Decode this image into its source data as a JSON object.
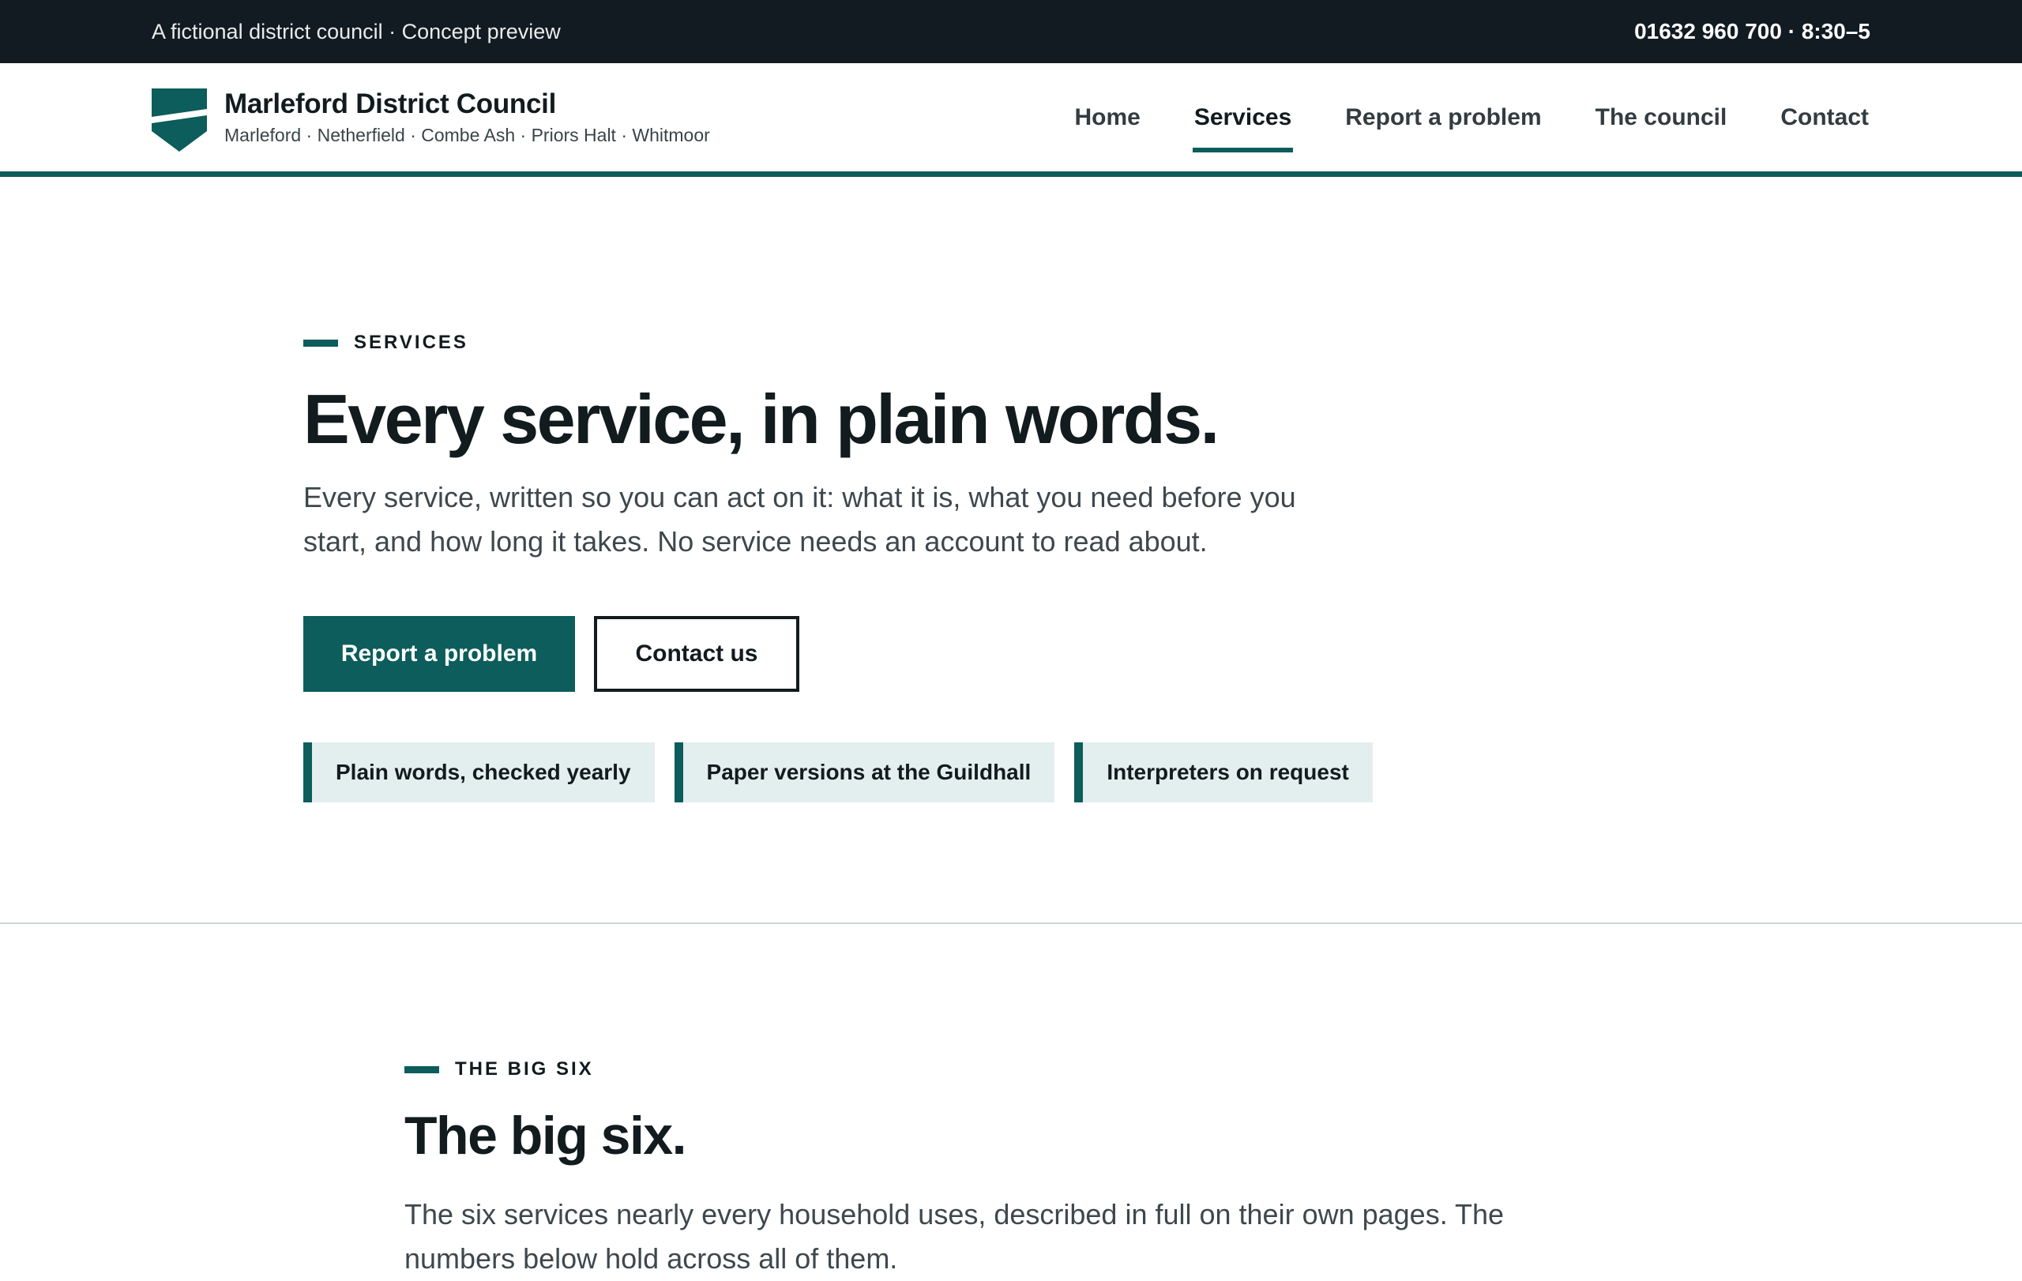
{
  "utility_bar": {
    "left_text": "A fictional district council · Concept preview",
    "right_text": "01632 960 700 · 8:30–5"
  },
  "header": {
    "brand_name": "Marleford District Council",
    "places": "Marleford · Netherfield · Combe Ash · Priors Halt · Whitmoor",
    "nav": [
      {
        "label": "Home",
        "active": false
      },
      {
        "label": "Services",
        "active": true
      },
      {
        "label": "Report a problem",
        "active": false
      },
      {
        "label": "The council",
        "active": false
      },
      {
        "label": "Contact",
        "active": false
      }
    ]
  },
  "hero": {
    "eyebrow": "SERVICES",
    "title": "Every service, in plain words.",
    "lede": "Every service, written so you can act on it: what it is, what you need before you start, and how long it takes. No service needs an account to read about.",
    "primary_cta": "Report a problem",
    "secondary_cta": "Contact us",
    "badges": [
      "Plain words, checked yearly",
      "Paper versions at the Guildhall",
      "Interpreters on request"
    ]
  },
  "big_six": {
    "eyebrow": "THE BIG SIX",
    "title": "The big six.",
    "lede": "The six services nearly every household uses, described in full on their own pages. The numbers below hold across all of them."
  },
  "colors": {
    "accent": "#0c5d5b",
    "utility_bar_bg": "#121b22",
    "badge_bg": "#e3eeee",
    "text": "#121b1e"
  }
}
